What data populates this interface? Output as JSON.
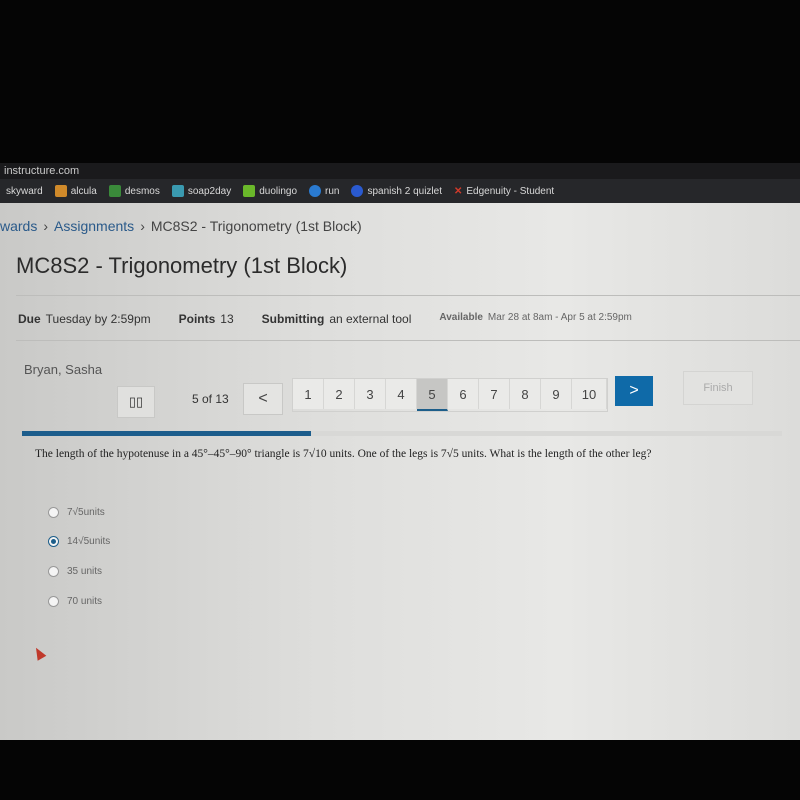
{
  "browser": {
    "url": "instructure.com",
    "bookmarks": [
      {
        "label": "skyward",
        "color": ""
      },
      {
        "label": "alcula",
        "color": "#d08a2a"
      },
      {
        "label": "desmos",
        "color": "#3a8a3a"
      },
      {
        "label": "soap2day",
        "color": "#3a9ab0"
      },
      {
        "label": "duolingo",
        "color": "#6ab82a"
      },
      {
        "label": "run",
        "color": "#2a7ad0"
      },
      {
        "label": "spanish 2 quizlet",
        "color": "#2a5ad0"
      },
      {
        "label": "Edgenuity - Student",
        "color": "#d03a2a"
      }
    ]
  },
  "breadcrumb": [
    "wards",
    "Assignments",
    "MC8S2 - Trigonometry (1st Block)"
  ],
  "page_title": "MC8S2 - Trigonometry (1st Block)",
  "meta": {
    "due_label": "Due",
    "due_value": "Tuesday by 2:59pm",
    "points_label": "Points",
    "points_value": "13",
    "submitting_label": "Submitting",
    "submitting_value": "an external tool",
    "available_label": "Available",
    "available_value": "Mar 28 at 8am - Apr 5 at 2:59pm"
  },
  "quiz": {
    "student": "Bryan, Sasha",
    "pause_icon": "pause-icon",
    "counter": "5 of 13",
    "prev": "<",
    "next": ">",
    "pages": [
      "1",
      "2",
      "3",
      "4",
      "5",
      "6",
      "7",
      "8",
      "9",
      "10"
    ],
    "current_page": "5",
    "finish": "Finish",
    "progress_percent": 38,
    "accent": "#0f6aa8",
    "question": "The length of the hypotenuse in a 45°–45°–90° triangle is 7√10 units. One of the legs is 7√5 units. What is the length of the other leg?",
    "options": [
      {
        "label": "7√5units",
        "selected": false
      },
      {
        "label": "14√5units",
        "selected": true
      },
      {
        "label": "35 units",
        "selected": false
      },
      {
        "label": "70 units",
        "selected": false
      }
    ]
  }
}
